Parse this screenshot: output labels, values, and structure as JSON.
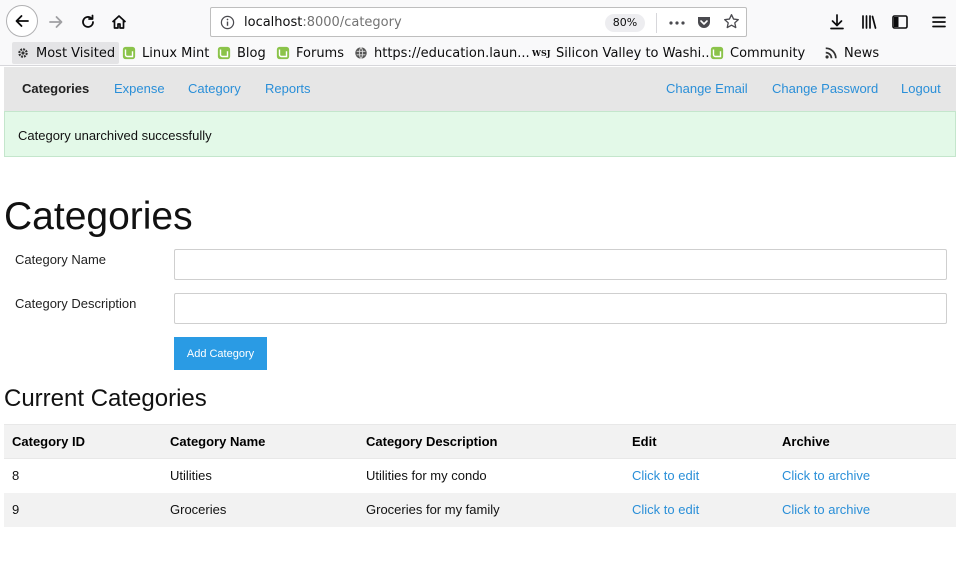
{
  "browser": {
    "url_host": "localhost",
    "url_path": ":8000/category",
    "zoom": "80%",
    "bookmarks": [
      {
        "label": "Most Visited",
        "icon": "gear-icon"
      },
      {
        "label": "Linux Mint",
        "icon": "linux-mint-icon"
      },
      {
        "label": "Blog",
        "icon": "linux-mint-icon"
      },
      {
        "label": "Forums",
        "icon": "linux-mint-icon"
      },
      {
        "label": "https://education.laun...",
        "icon": "globe-icon"
      },
      {
        "label": "Silicon Valley to Washi...",
        "icon": "wsj-icon"
      },
      {
        "label": "Community",
        "icon": "linux-mint-icon"
      },
      {
        "label": "News",
        "icon": "rss-icon"
      }
    ],
    "wsj_icon_text": "WSJ"
  },
  "nav": {
    "brand": "Categories",
    "left_links": [
      "Expense",
      "Category",
      "Reports"
    ],
    "right_links": [
      "Change Email",
      "Change Password",
      "Logout"
    ]
  },
  "flash": {
    "message": "Category unarchived successfully"
  },
  "main": {
    "title": "Categories",
    "name_label": "Category Name",
    "name_value": "",
    "description_label": "Category Description",
    "description_value": "",
    "add_button": "Add Category",
    "list_title": "Current Categories"
  },
  "table": {
    "headers": [
      "Category ID",
      "Category Name",
      "Category Description",
      "Edit",
      "Archive"
    ],
    "rows": [
      {
        "id": "8",
        "name": "Utilities",
        "description": "Utilities for my condo",
        "edit": "Click to edit",
        "archive": "Click to archive"
      },
      {
        "id": "9",
        "name": "Groceries",
        "description": "Groceries for my family",
        "edit": "Click to edit",
        "archive": "Click to archive"
      }
    ]
  },
  "colors": {
    "link": "#2a8fd8",
    "button": "#2a9be4",
    "flash_bg": "#e3f9e8",
    "nav_bg": "#e6e6e6"
  }
}
